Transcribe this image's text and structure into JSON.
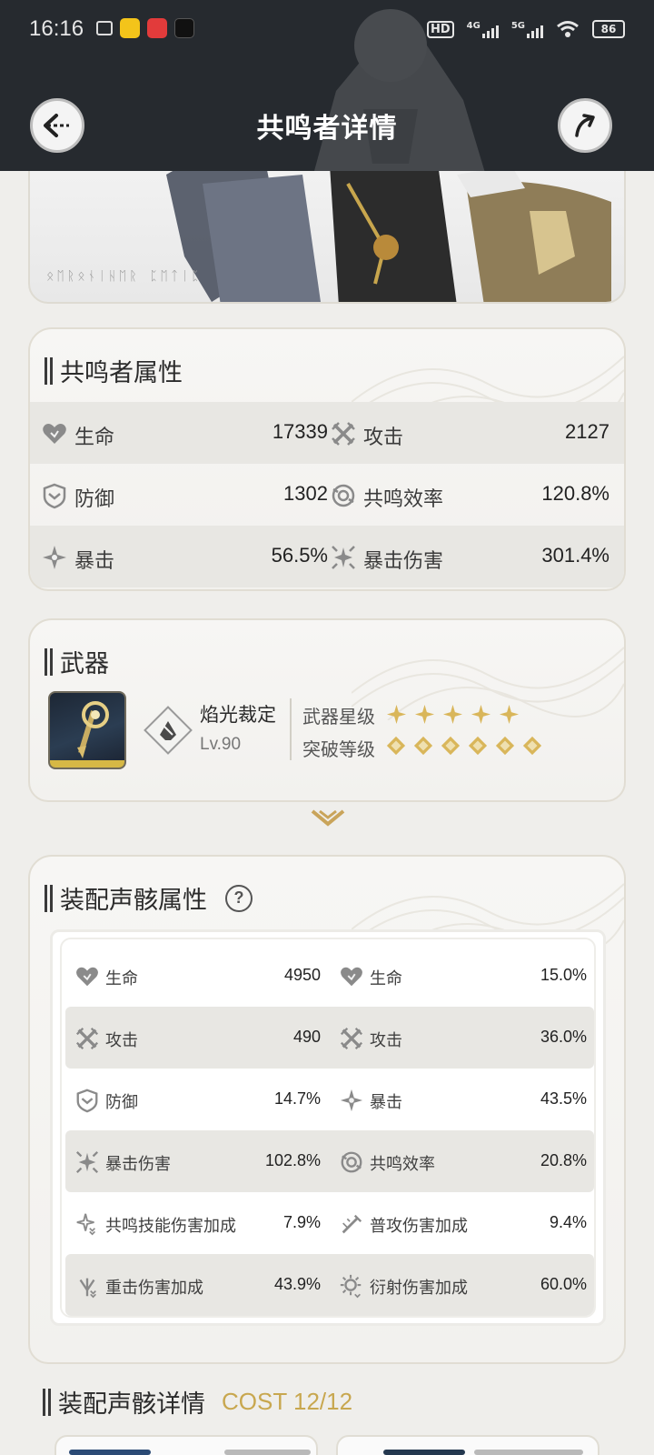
{
  "status_bar": {
    "time": "16:16",
    "network_4g": "4G",
    "network_5g": "5G",
    "hd": "HD",
    "battery": "86"
  },
  "header": {
    "title": "共鸣者详情",
    "back_icon": "back-arrow-icon",
    "share_icon": "share-arrow-icon"
  },
  "banner": {
    "rune_text": "ᛟᛖᚱᛟᚾᛁᚺᛖᚱ ᛈᛖᛏᛁᛈ"
  },
  "resonator_attributes": {
    "title": "共鸣者属性",
    "rows": [
      [
        {
          "icon": "hp-heart-icon",
          "label": "生命",
          "value": "17339"
        },
        {
          "icon": "attack-swords-icon",
          "label": "攻击",
          "value": "2127"
        }
      ],
      [
        {
          "icon": "defense-shield-icon",
          "label": "防御",
          "value": "1302"
        },
        {
          "icon": "energy-regen-icon",
          "label": "共鸣效率",
          "value": "120.8%"
        }
      ],
      [
        {
          "icon": "crit-star-icon",
          "label": "暴击",
          "value": "56.5%"
        },
        {
          "icon": "crit-damage-icon",
          "label": "暴击伤害",
          "value": "301.4%"
        }
      ]
    ]
  },
  "weapon": {
    "title": "武器",
    "name": "焰光裁定",
    "level": "Lv.90",
    "rank_label": "武器星级",
    "rank": 5,
    "refine_label": "突破等级",
    "refine": 6,
    "accent": "#d9b65a"
  },
  "echo_attributes": {
    "title": "装配声骸属性",
    "help": "?",
    "rows": [
      [
        {
          "icon": "hp-heart-icon",
          "label": "生命",
          "value": "4950"
        },
        {
          "icon": "hp-heart-icon",
          "label": "生命",
          "value": "15.0%"
        }
      ],
      [
        {
          "icon": "attack-swords-icon",
          "label": "攻击",
          "value": "490"
        },
        {
          "icon": "attack-swords-icon",
          "label": "攻击",
          "value": "36.0%"
        }
      ],
      [
        {
          "icon": "defense-shield-icon",
          "label": "防御",
          "value": "14.7%"
        },
        {
          "icon": "crit-star-icon",
          "label": "暴击",
          "value": "43.5%"
        }
      ],
      [
        {
          "icon": "crit-damage-icon",
          "label": "暴击伤害",
          "value": "102.8%"
        },
        {
          "icon": "energy-regen-icon",
          "label": "共鸣效率",
          "value": "20.8%"
        }
      ],
      [
        {
          "icon": "skill-damage-icon",
          "label": "共鸣技能伤害加成",
          "value": "7.9%"
        },
        {
          "icon": "basic-attack-icon",
          "label": "普攻伤害加成",
          "value": "9.4%"
        }
      ],
      [
        {
          "icon": "heavy-attack-icon",
          "label": "重击伤害加成",
          "value": "43.9%"
        },
        {
          "icon": "spectro-damage-icon",
          "label": "衍射伤害加成",
          "value": "60.0%"
        }
      ]
    ]
  },
  "echo_details": {
    "title": "装配声骸详情",
    "cost": "COST 12/12"
  }
}
